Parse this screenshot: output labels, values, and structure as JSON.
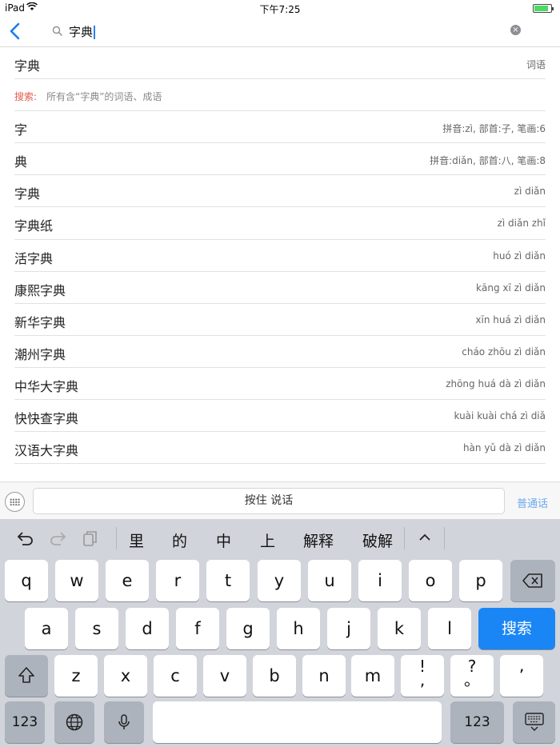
{
  "status": {
    "device": "iPad",
    "time": "下午7:25",
    "battery_level": 0.85
  },
  "search": {
    "query": "字典",
    "clear": "×"
  },
  "rows": [
    {
      "main": "字典",
      "sub": "词语"
    },
    {
      "search_label": "搜索:",
      "search_desc": "所有含“字典”的词语、成语"
    },
    {
      "main": "字",
      "sub": "拼音:zì, 部首:子, 笔画:6"
    },
    {
      "main": "典",
      "sub": "拼音:diǎn, 部首:八, 笔画:8"
    },
    {
      "main": "字典",
      "sub": "zì diǎn"
    },
    {
      "main": "字典纸",
      "sub": "zì diǎn zhǐ"
    },
    {
      "main": "活字典",
      "sub": "huó zì diǎn"
    },
    {
      "main": "康熙字典",
      "sub": "kāng xī zì diǎn"
    },
    {
      "main": "新华字典",
      "sub": "xīn huá zì diǎn"
    },
    {
      "main": "潮州字典",
      "sub": "cháo zhōu zì diǎn"
    },
    {
      "main": "中华大字典",
      "sub": "zhōng huá dà zì diǎn"
    },
    {
      "main": "快快查字典",
      "sub": "kuài kuài chá zì diǎ"
    },
    {
      "main": "汉语大字典",
      "sub": "hàn yǔ dà zì diǎn"
    }
  ],
  "voice": {
    "hold_label": "按住 说话",
    "mode_label": "普通话"
  },
  "candidates": [
    "里",
    "的",
    "中",
    "上",
    "解释",
    "破解"
  ],
  "keyboard": {
    "row1": [
      "q",
      "w",
      "e",
      "r",
      "t",
      "y",
      "u",
      "i",
      "o",
      "p"
    ],
    "row2": [
      "a",
      "s",
      "d",
      "f",
      "g",
      "h",
      "j",
      "k",
      "l"
    ],
    "row3": [
      "z",
      "x",
      "c",
      "v",
      "b",
      "n",
      "m"
    ],
    "punct1_top": "!",
    "punct1_bottom": ",",
    "punct2_top": "?",
    "punct2_bottom": "。",
    "apostrophe": "’",
    "search_key": "搜索",
    "num_key_left": "123",
    "num_key_right": "123"
  }
}
